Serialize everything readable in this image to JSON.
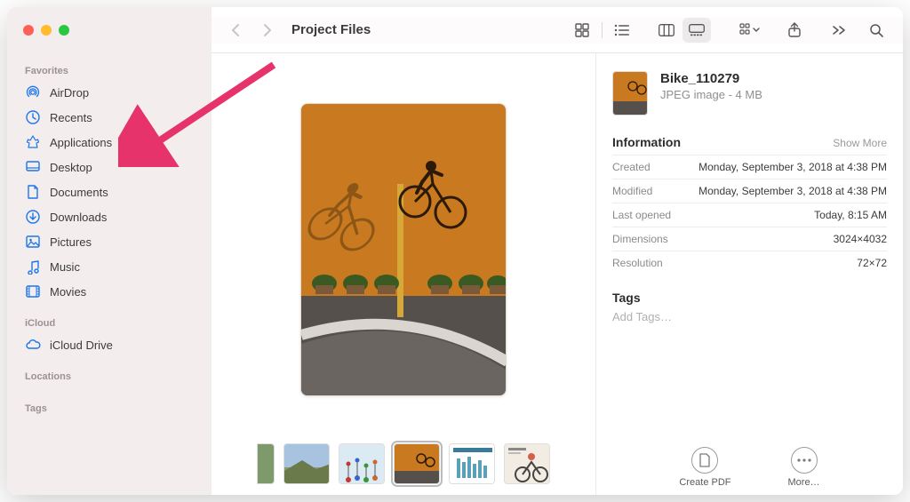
{
  "window_title": "Project Files",
  "sidebar": {
    "sections": [
      {
        "label": "Favorites",
        "items": [
          {
            "icon": "airdrop",
            "label": "AirDrop"
          },
          {
            "icon": "clock",
            "label": "Recents"
          },
          {
            "icon": "apps",
            "label": "Applications"
          },
          {
            "icon": "desktop",
            "label": "Desktop"
          },
          {
            "icon": "doc",
            "label": "Documents"
          },
          {
            "icon": "download",
            "label": "Downloads"
          },
          {
            "icon": "pictures",
            "label": "Pictures"
          },
          {
            "icon": "music",
            "label": "Music"
          },
          {
            "icon": "movies",
            "label": "Movies"
          }
        ]
      },
      {
        "label": "iCloud",
        "items": [
          {
            "icon": "cloud",
            "label": "iCloud Drive"
          }
        ]
      },
      {
        "label": "Locations",
        "items": []
      },
      {
        "label": "Tags",
        "items": []
      }
    ]
  },
  "inspector": {
    "filename": "Bike_110279",
    "file_kind": "JPEG image - 4 MB",
    "info_heading": "Information",
    "show_more": "Show More",
    "rows": [
      {
        "k": "Created",
        "v": "Monday, September 3, 2018 at 4:38 PM"
      },
      {
        "k": "Modified",
        "v": "Monday, September 3, 2018 at 4:38 PM"
      },
      {
        "k": "Last opened",
        "v": "Today, 8:15 AM"
      },
      {
        "k": "Dimensions",
        "v": "3024×4032"
      },
      {
        "k": "Resolution",
        "v": "72×72"
      }
    ],
    "tags_heading": "Tags",
    "add_tags_placeholder": "Add Tags…",
    "footer": {
      "create_pdf": "Create PDF",
      "more": "More…"
    }
  },
  "annotation": {
    "target": "Applications"
  }
}
